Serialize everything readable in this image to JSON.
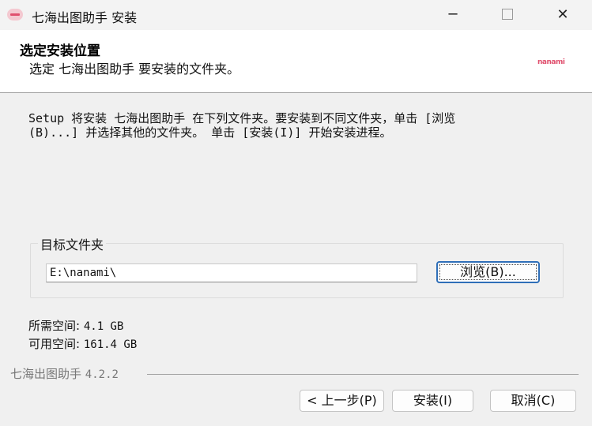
{
  "window": {
    "title": "七海出图助手 安装",
    "minimize_glyph": "─",
    "close_glyph": "✕"
  },
  "header": {
    "title": "选定安装位置",
    "subtitle": "选定 七海出图助手 要安装的文件夹。",
    "logo_text": "nanami"
  },
  "intro": {
    "line1": "Setup 将安装 七海出图助手 在下列文件夹。要安装到不同文件夹，单击 [浏览",
    "line2": "(B)...] 并选择其他的文件夹。 单击 [安装(I)] 开始安装进程。"
  },
  "destination": {
    "group_label": "目标文件夹",
    "path_value": "E:\\nanami\\",
    "browse_label": "浏览(B)..."
  },
  "space": {
    "required_label": "所需空间:",
    "required_value": "4.1 GB",
    "available_label": "可用空间:",
    "available_value": "161.4 GB"
  },
  "footer": {
    "brand": "七海出图助手",
    "version": "4.2.2",
    "back_label": "< 上一步(P)",
    "install_label": "安装(I)",
    "cancel_label": "取消(C)"
  },
  "colors": {
    "accent": "#2f6fb8",
    "logo": "#e0506e"
  }
}
